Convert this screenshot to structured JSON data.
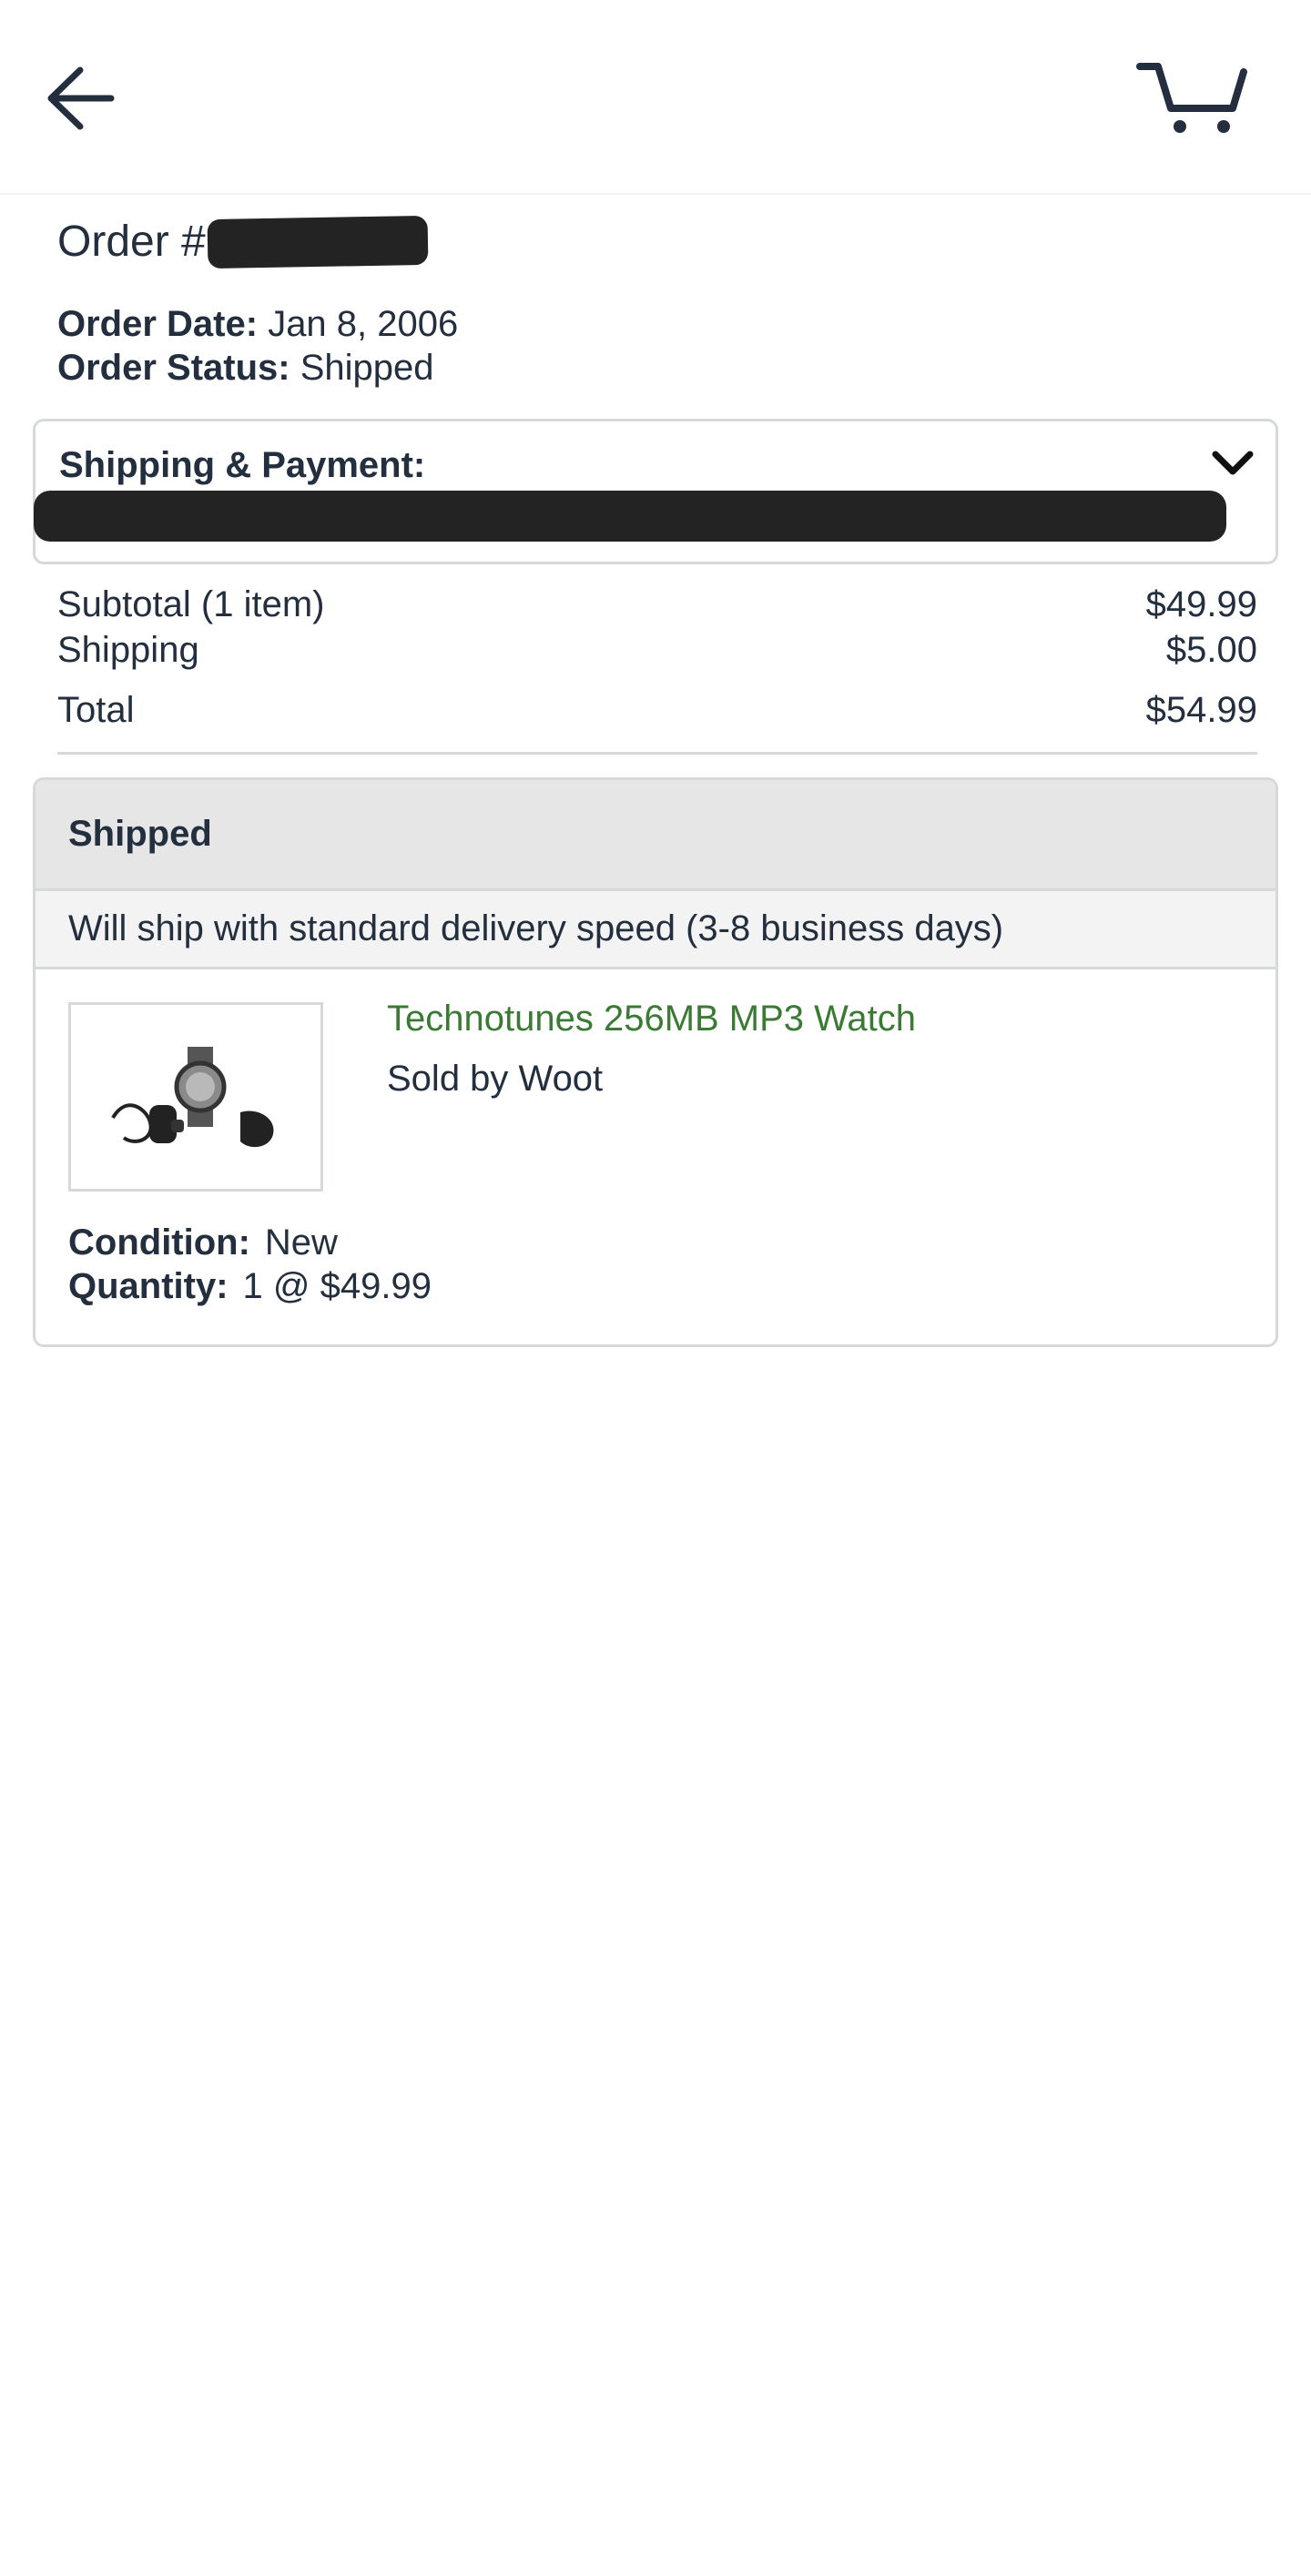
{
  "header": {
    "back_icon": "arrow-left-icon",
    "cart_icon": "cart-icon"
  },
  "order": {
    "number_prefix": "Order #",
    "date_label": "Order Date:",
    "date_value": "Jan 8, 2006",
    "status_label": "Order Status:",
    "status_value": "Shipped"
  },
  "shipping_payment": {
    "label": "Shipping & Payment:",
    "toggle_icon": "chevron-down-icon"
  },
  "summary": {
    "subtotal_label": "Subtotal (1 item)",
    "subtotal_value": "$49.99",
    "shipping_label": "Shipping",
    "shipping_value": "$5.00",
    "total_label": "Total",
    "total_value": "$54.99"
  },
  "shipment": {
    "status": "Shipped",
    "delivery_note": "Will ship with standard delivery speed (3-8 business days)",
    "item": {
      "title": "Technotunes 256MB MP3 Watch",
      "seller": "Sold by Woot",
      "condition_label": "Condition:",
      "condition_value": "New",
      "quantity_label": "Quantity:",
      "quantity_value": "1 @ $49.99"
    }
  },
  "colors": {
    "text_dark": "#232f3e",
    "link_green": "#3a7a34",
    "border": "#d5d9d9",
    "header_bg": "#e6e6e6",
    "redaction": "#232323"
  }
}
